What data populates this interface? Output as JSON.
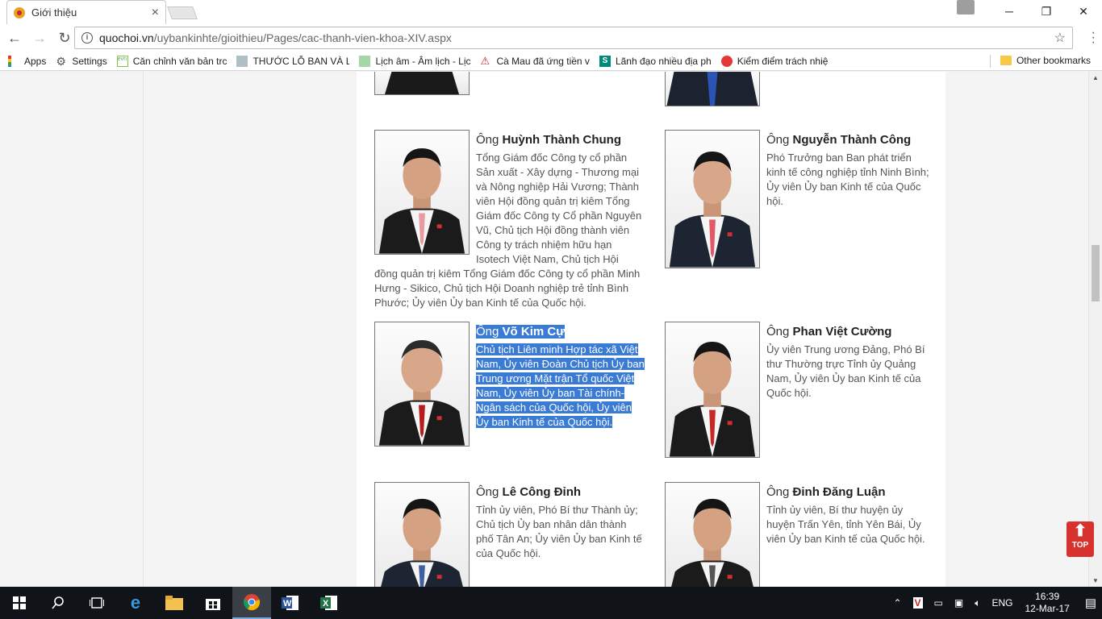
{
  "browser": {
    "tab_title": "Giới thiệu",
    "tab_close": "×",
    "url_domain": "quochoi.vn",
    "url_path": "/uybankinhte/gioithieu/Pages/cac-thanh-vien-khoa-XIV.aspx",
    "window_minimize": "─",
    "window_maximize": "❐",
    "window_close": "✕"
  },
  "bookmarks": {
    "items": [
      {
        "label": "Apps"
      },
      {
        "label": "Settings"
      },
      {
        "label": "Căn chỉnh văn bản trc"
      },
      {
        "label": "THƯỚC LỖ BAN VÀ LA"
      },
      {
        "label": "Lịch âm - Âm lịch - Lịc"
      },
      {
        "label": "Cà Mau đã ứng tiền v"
      },
      {
        "label": "Lãnh đạo nhiều địa ph"
      },
      {
        "label": "Kiểm điểm trách nhiệ"
      }
    ],
    "other": "Other bookmarks"
  },
  "members": [
    {
      "prefix": "Ông ",
      "name": "Huỳnh Thành Chung",
      "description": "Tổng Giám đốc Công ty cổ phần Sản xuất - Xây dựng - Thương mại và Nông nghiệp Hải Vương; Thành viên Hội đồng quản trị kiêm Tổng Giám đốc Công ty Cổ phần Nguyên Vũ, Chủ tịch Hội đồng thành viên Công ty trách nhiệm hữu hạn Isotech Việt Nam, Chủ tịch Hội đồng quản trị kiêm Tổng Giám đốc Công ty cổ phần Minh Hưng - Sikico, Chủ tịch Hội Doanh nghiệp trẻ tỉnh Bình Phước; Ủy viên Ủy ban Kinh tế của Quốc hội."
    },
    {
      "prefix": "Ông ",
      "name": "Nguyễn Thành Công",
      "description": "Phó Trưởng ban Ban phát triển kinh tế công nghiệp tỉnh Ninh Bình; Ủy viên Ủy ban Kinh tế của Quốc hội."
    },
    {
      "prefix": "Ông ",
      "name": "Võ Kim Cự",
      "description": "Chủ tịch Liên minh Hợp tác xã Việt Nam, Ủy viên Đoàn Chủ tịch Ủy ban Trung ương Mặt trận Tổ quốc Việt Nam, Ủy viên Ủy ban Tài chính-Ngân sách của Quốc hội, Ủy viên Ủy ban Kinh tế của Quốc hội."
    },
    {
      "prefix": "Ông ",
      "name": "Phan Việt Cường",
      "description": "Ủy viên Trung ương Đảng, Phó Bí thư Thường trực Tỉnh ủy Quảng Nam, Ủy viên Ủy ban Kinh tế của Quốc hội."
    },
    {
      "prefix": "Ông ",
      "name": "Lê Công Đỉnh",
      "description": "Tỉnh ủy viên, Phó Bí thư Thành ủy; Chủ tịch Ủy ban nhân dân thành phố Tân An; Ủy viên Ủy ban Kinh tế của Quốc hội."
    },
    {
      "prefix": "Ông ",
      "name": "Đinh Đăng Luận",
      "description": "Tỉnh ủy viên, Bí thư huyện ủy huyện Trấn Yên, tỉnh Yên Bái, Ủy viên Ủy ban Kinh tế của Quốc hội."
    }
  ],
  "top_button": "TOP",
  "taskbar": {
    "lang": "ENG",
    "time": "16:39",
    "date": "12-Mar-17"
  },
  "colors": {
    "selection": "#3a7bd5",
    "top_button": "#d8322e"
  }
}
